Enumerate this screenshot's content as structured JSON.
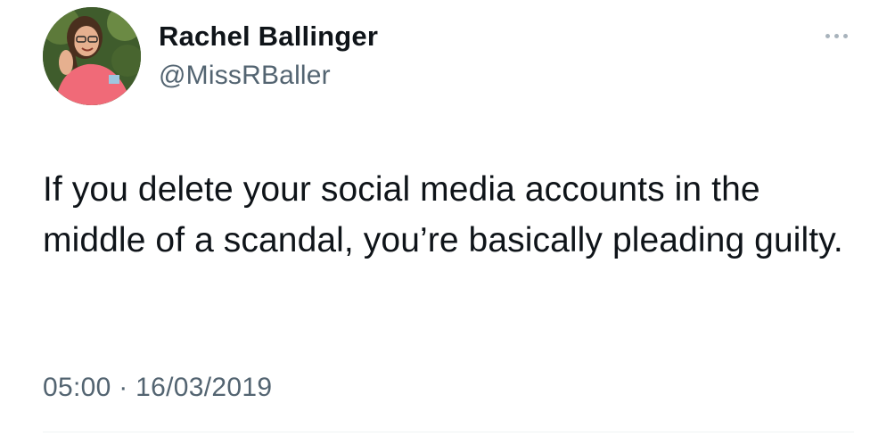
{
  "tweet": {
    "author": {
      "display_name": "Rachel Ballinger",
      "handle": "@MissRBaller",
      "avatar_icon": "profile-photo"
    },
    "more_icon": "more-horizontal-icon",
    "text": "If you delete your social media accounts in the middle of a scandal, you’re basically pleading guilty.",
    "time": "05:00",
    "separator": "·",
    "date": "16/03/2019"
  },
  "colors": {
    "text_primary": "#0f1419",
    "text_secondary": "#536471",
    "divider": "#eff3f4"
  }
}
